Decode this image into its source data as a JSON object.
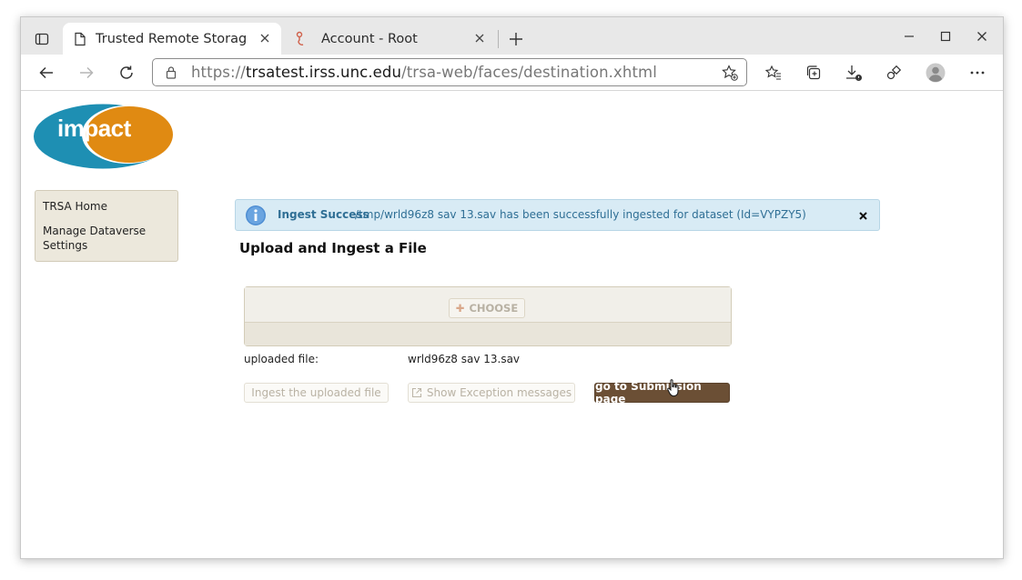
{
  "browser": {
    "tabs": [
      {
        "title": "Trusted Remote Storage A",
        "active": true,
        "icon": "document-icon"
      },
      {
        "title": "Account - Root",
        "active": false,
        "icon": "app-favicon-icon"
      }
    ],
    "url_prefix": "https://",
    "url_host": "trsatest.irss.unc.edu",
    "url_path": "/trsa-web/faces/destination.xhtml"
  },
  "logo": {
    "text": "impact",
    "colors": {
      "left": "#1e8fb3",
      "right": "#e08a12"
    }
  },
  "sidebar": {
    "items": [
      {
        "label": "TRSA Home"
      },
      {
        "label": "Manage Dataverse Settings"
      }
    ]
  },
  "message": {
    "summary": "Ingest Success",
    "detail": "/tmp/wrld96z8 sav 13.sav has been successfully ingested for dataset (Id=VYPZY5)"
  },
  "main": {
    "heading": "Upload and Ingest a File",
    "choose_label": "CHOOSE",
    "uploaded_file_label": "uploaded file:",
    "uploaded_file_value": "wrld96z8 sav 13.sav",
    "ingest_button": "Ingest the uploaded file",
    "exception_button": "Show Exception messages",
    "submission_button": "go to Submission page"
  },
  "colors": {
    "primary_button": "#6b4f35",
    "message_bg": "#d8ebf5",
    "message_text": "#2f6f95"
  }
}
